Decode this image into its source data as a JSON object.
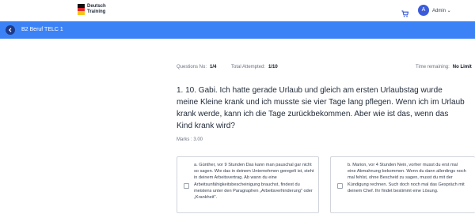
{
  "header": {
    "logo_line1": "Deutsch",
    "logo_line2": "Training",
    "avatar_initial": "A",
    "user_label": "Admin ⌄",
    "accent": "#3b82f6",
    "icons": [
      "cart-icon",
      "back-arrow-icon",
      "chevron-down-icon"
    ]
  },
  "subheader": {
    "course_title": "B2 Beruf TELC 1"
  },
  "quiz": {
    "questions_no_label": "Questions No:",
    "questions_no_value": "1/4",
    "attempted_label": "Total Attempted:",
    "attempted_value": "1/10",
    "time_label": "Time remaining:",
    "time_value": "No Limit",
    "question_text": "1. 10. Gabi. Ich hatte gerade Urlaub und gleich am ersten Urlaubstag wurde meine Kleine krank und ich musste sie vier Tage lang pflegen. Wenn ich im Urlaub krank werde, kann ich die Tage zurückbekommen. Aber wie ist das, wenn das Kind krank wird?",
    "marks": "Marks : 3.00",
    "options": [
      {
        "text": "a. Günther, vor 9 Stunden Das kann man pauschal gar nicht so sagen. Wie das in deinem Unternehmen geregelt ist, steht in deinem Arbeitsvertrag. Ab wann du eine Arbeitsunfähigkeitsbescheinigung brauchst, findest du meistens unter den Paragraphen „Arbeitsverhinderung\" oder „Krankheit\"."
      },
      {
        "text": "b. Marion, vor 4 Stunden Nein, vorher musst du erst mal eine Abmahnung bekommen. Wenn du dann allerdings noch mal fehlst, ohne Bescheid zu sagen, musst du mit der Kündigung rechnen. Such doch noch mal das Gespräch mit deinem Chef. Ihr findet bestimmt eine Lösung."
      }
    ]
  }
}
